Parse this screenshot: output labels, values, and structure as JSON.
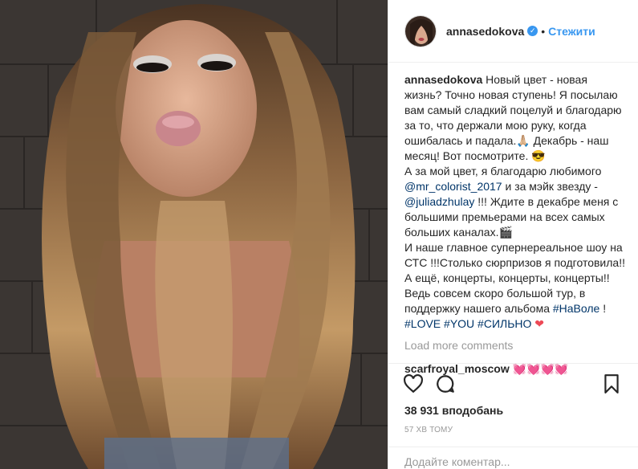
{
  "post": {
    "username": "annasedokova",
    "verified_icon": "verified-badge-icon",
    "separator": "•",
    "follow_label": "Стежити"
  },
  "caption": {
    "author": "annasedokova",
    "text_1": " Новый цвет - новая жизнь? Точно новая ступень! Я посылаю вам самый сладкий поцелуй и благодарю за то, что держали мою руку, когда ошибалась и падала.🙏🏼 Декабрь - наш месяц! Вот посмотрите. 😎\nА за мой цвет, я благодарю любимого ",
    "mention_1": "@mr_colorist_2017",
    "text_2": " и за мэйк звезду - ",
    "mention_2": "@juliadzhulay",
    "text_3": " !!! Ждите в декабре меня с большими премьерами на всех самых больших каналах.🎬\nИ наше главное супернереальное шоу на СТС !!!Столько сюрпризов я подготовила!! А ещё, концерты, концерты, концерты!! Ведь совсем скоро большой тур, в поддержку нашего альбома ",
    "hashtag_1": "#НаВоле",
    "text_4": " !\n",
    "hashtag_2": "#LOVE",
    "hashtag_3": "#YOU",
    "hashtag_4": "#СИЛЬНО",
    "heart": "❤"
  },
  "load_more": "Load more comments",
  "comment": {
    "author": "scarfroyal_moscow",
    "text": "💓💓💓💓"
  },
  "actions": {
    "like_icon": "heart-icon",
    "comment_icon": "comment-icon",
    "save_icon": "bookmark-icon"
  },
  "likes_text": "38 931 вподобань",
  "timestamp": "57 ХВ ТОМУ",
  "add_comment_placeholder": "Додайте коментар...",
  "colors": {
    "link": "#003569",
    "follow": "#3897f0",
    "heart": "#ed4956"
  }
}
